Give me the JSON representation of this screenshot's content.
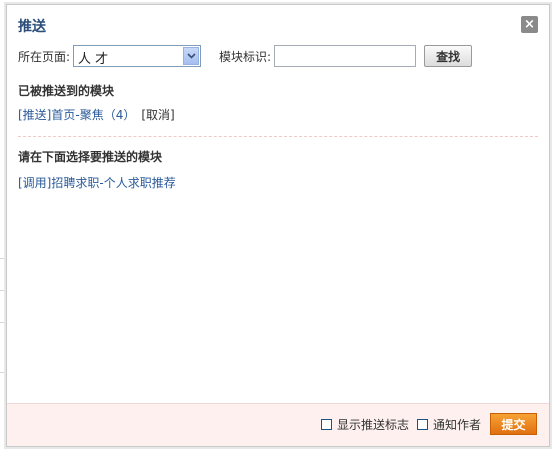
{
  "dialog": {
    "title": "推送",
    "close_symbol": "×"
  },
  "filters": {
    "page_label": "所在页面:",
    "page_selected": "人 才",
    "module_label": "模块标识:",
    "module_value": "",
    "find_label": "查找"
  },
  "pushed": {
    "heading": "已被推送到的模块",
    "item_link": "[推送]首页-聚焦（4）",
    "cancel_label": "[取消]"
  },
  "choose": {
    "heading": "请在下面选择要推送的模块",
    "item_link": "[调用]招聘求职-个人求职推荐"
  },
  "footer": {
    "show_flag_label": "显示推送标志",
    "notify_author_label": "通知作者",
    "submit_label": "提交"
  },
  "colors": {
    "title": "#2a4d7a",
    "link": "#2a5a9a",
    "footer_bg": "#fdf0ef",
    "submit_bg": "#e98a1f"
  }
}
